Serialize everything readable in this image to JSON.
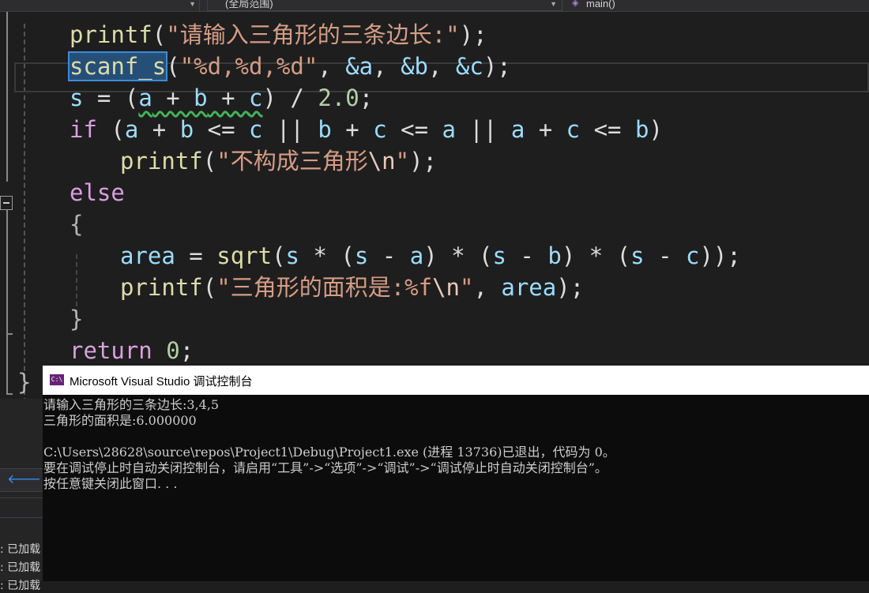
{
  "nav": {
    "left_dropdown": "",
    "scope_dropdown": "(全局范围)",
    "member_dropdown": "main()"
  },
  "code": {
    "line1": [
      "printf",
      "(",
      "\"请输入三角形的三条边长:\"",
      ");"
    ],
    "line2": [
      "scanf_s",
      "(",
      "\"%d,%d,%d\"",
      ", ",
      "&a",
      ", ",
      "&b",
      ", ",
      "&c",
      ");"
    ],
    "line3": [
      "s",
      " = (",
      "a",
      " + ",
      "b",
      " + ",
      "c",
      ") / ",
      "2.0",
      ";"
    ],
    "line4": [
      "if",
      " (",
      "a",
      " + ",
      "b",
      " <= ",
      "c",
      " || ",
      "b",
      " + ",
      "c",
      " <= ",
      "a",
      " || ",
      "a",
      " + ",
      "c",
      " <= ",
      "b",
      ")"
    ],
    "line5": [
      "printf",
      "(",
      "\"不构成三角形",
      "\\n",
      "\"",
      ");"
    ],
    "line6": "else",
    "line7": "{",
    "line8": [
      "area",
      " = ",
      "sqrt",
      "(",
      "s",
      " * (",
      "s",
      " - ",
      "a",
      ") * (",
      "s",
      " - ",
      "b",
      ") * (",
      "s",
      " - ",
      "c",
      "));"
    ],
    "line9": [
      "printf",
      "(",
      "\"三角形的面积是:%f",
      "\\n",
      "\"",
      ", ",
      "area",
      ");"
    ],
    "line10": "}",
    "line11": [
      "return",
      " ",
      "0",
      ";"
    ],
    "line12": "}"
  },
  "console": {
    "icon": "C:\\",
    "title": "Microsoft Visual Studio 调试控制台",
    "lines": [
      "请输入三角形的三条边长:3,4,5",
      "三角形的面积是:6.000000",
      "",
      "C:\\Users\\28628\\source\\repos\\Project1\\Debug\\Project1.exe (进程 13736)已退出，代码为 0。",
      "要在调试停止时自动关闭控制台，请启用“工具”->“选项”->“调试”->“调试停止时自动关闭控制台”。",
      "按任意键关闭此窗口. . ."
    ]
  },
  "leftpanel": {
    "lines": [
      ": 已加载",
      ": 已加载",
      ": 已加载"
    ]
  }
}
